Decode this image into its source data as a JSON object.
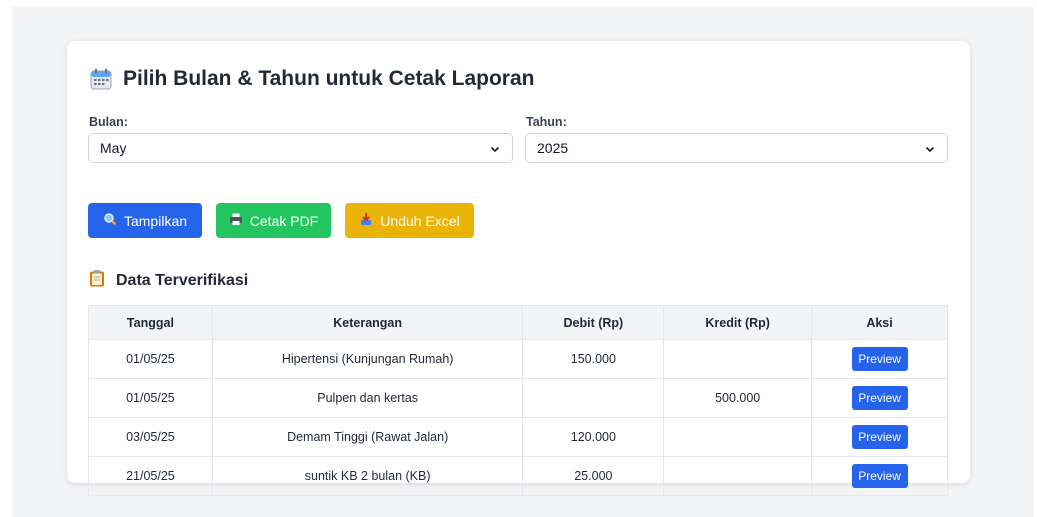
{
  "header": {
    "title": "Pilih Bulan & Tahun untuk Cetak Laporan",
    "icon": "calendar-icon"
  },
  "filters": {
    "month_label": "Bulan:",
    "month_value": "May",
    "year_label": "Tahun:",
    "year_value": "2025"
  },
  "actions": {
    "show_label": "Tampilkan",
    "pdf_label": "Cetak PDF",
    "excel_label": "Unduh Excel"
  },
  "section": {
    "title": "Data Terverifikasi",
    "icon": "clipboard-icon"
  },
  "table": {
    "headers": [
      "Tanggal",
      "Keterangan",
      "Debit (Rp)",
      "Kredit (Rp)",
      "Aksi"
    ],
    "rows": [
      {
        "date": "01/05/25",
        "desc": "Hipertensi (Kunjungan Rumah)",
        "debit": "150.000",
        "credit": "",
        "action": "Preview"
      },
      {
        "date": "01/05/25",
        "desc": "Pulpen dan kertas",
        "debit": "",
        "credit": "500.000",
        "action": "Preview"
      },
      {
        "date": "03/05/25",
        "desc": "Demam Tinggi (Rawat Jalan)",
        "debit": "120.000",
        "credit": "",
        "action": "Preview"
      },
      {
        "date": "21/05/25",
        "desc": "suntik KB 2 bulan (KB)",
        "debit": "25.000",
        "credit": "",
        "action": "Preview"
      }
    ]
  },
  "colors": {
    "primary": "#2563eb",
    "success": "#22c55e",
    "warning": "#eab308",
    "background": "#f3f4f6"
  }
}
